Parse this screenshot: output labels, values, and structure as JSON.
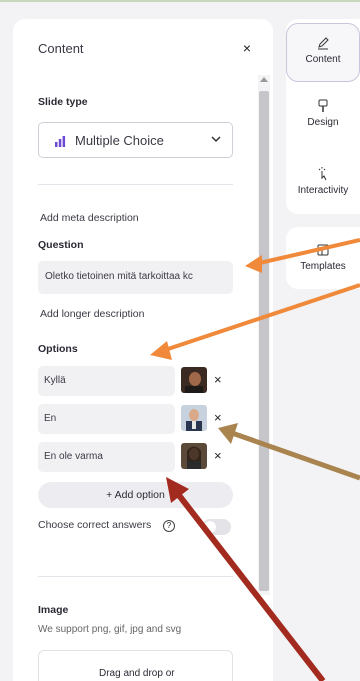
{
  "panel": {
    "title": "Content",
    "close_icon": "×"
  },
  "slide_type": {
    "label": "Slide type",
    "selected": "Multiple Choice"
  },
  "meta": {
    "add_meta_label": "Add meta description"
  },
  "question": {
    "label": "Question",
    "value": "Oletko tietoinen mitä tarkoittaa kc"
  },
  "longer_description": {
    "label": "Add longer description"
  },
  "options": {
    "label": "Options",
    "items": [
      {
        "value": "Kyllä"
      },
      {
        "value": "En"
      },
      {
        "value": "En ole varma"
      }
    ],
    "remove_icon": "×",
    "add_label": "+ Add option"
  },
  "correct_answers": {
    "label": "Choose correct answers",
    "help_icon": "?",
    "enabled": false
  },
  "image": {
    "label": "Image",
    "description": "We support png, gif, jpg and svg",
    "drop_text_line1": "Drag and drop or"
  },
  "tabs": [
    {
      "label": "Content",
      "icon": "pen-icon",
      "active": true
    },
    {
      "label": "Design",
      "icon": "paint-brush-icon",
      "active": false
    },
    {
      "label": "Interactivity",
      "icon": "interactivity-icon",
      "active": false
    },
    {
      "label": "Templates",
      "icon": "templates-icon",
      "active": false
    }
  ],
  "colors": {
    "accent_purple": "#6c4ad6",
    "arrow_orange": "#f08a3a",
    "arrow_tan": "#a9844e",
    "arrow_red": "#a32a1f"
  }
}
